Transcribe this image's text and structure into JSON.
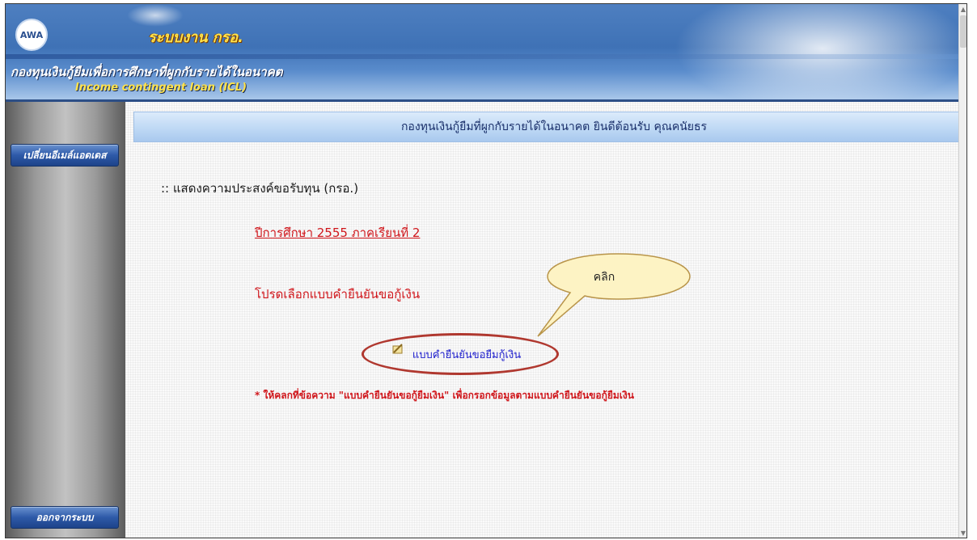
{
  "header": {
    "logo_text": "AWA",
    "system_name": "ระบบงาน กรอ.",
    "org_name_th": "กองทุนเงินกู้ยืมเพื่อการศึกษาที่ผูกกับรายได้ในอนาคต",
    "org_name_en": "Income contingent loan (ICL)"
  },
  "sidebar": {
    "change_email_label": "เปลี่ยนอีเมล์แอดเดส",
    "logout_label": "ออกจากระบบ"
  },
  "main": {
    "welcome": "กองทุนเงินกู้ยืมที่ผูกกับรายได้ในอนาคต ยินดีต้อนรับ คุณคนัยธร",
    "section_title": ":: แสดงความประสงค์ขอรับทุน (กรอ.)",
    "academic_year_link": "ปีการศึกษา 2555 ภาคเรียนที่ 2",
    "choose_form_text": "โปรดเลือกแบบคำยืนยันขอกู้เงิน",
    "form_link": "แบบคำยืนยันขอยืมกู้เงิน",
    "hint": "* ให้คลกที่ข้อความ \"แบบคำยืนยันขอกู้ยืมเงิน\" เพื่อกรอกข้อมูลตามแบบคำยืนยันขอกู้ยืมเงิน",
    "callout_text": "คลิก"
  },
  "colors": {
    "header_blue": "#3f72b6",
    "accent_red": "#d0161b",
    "link_blue": "#1c1ccc",
    "callout_fill": "#fdf3c4"
  },
  "icons": {
    "form_icon": "pencil-paper-icon"
  }
}
